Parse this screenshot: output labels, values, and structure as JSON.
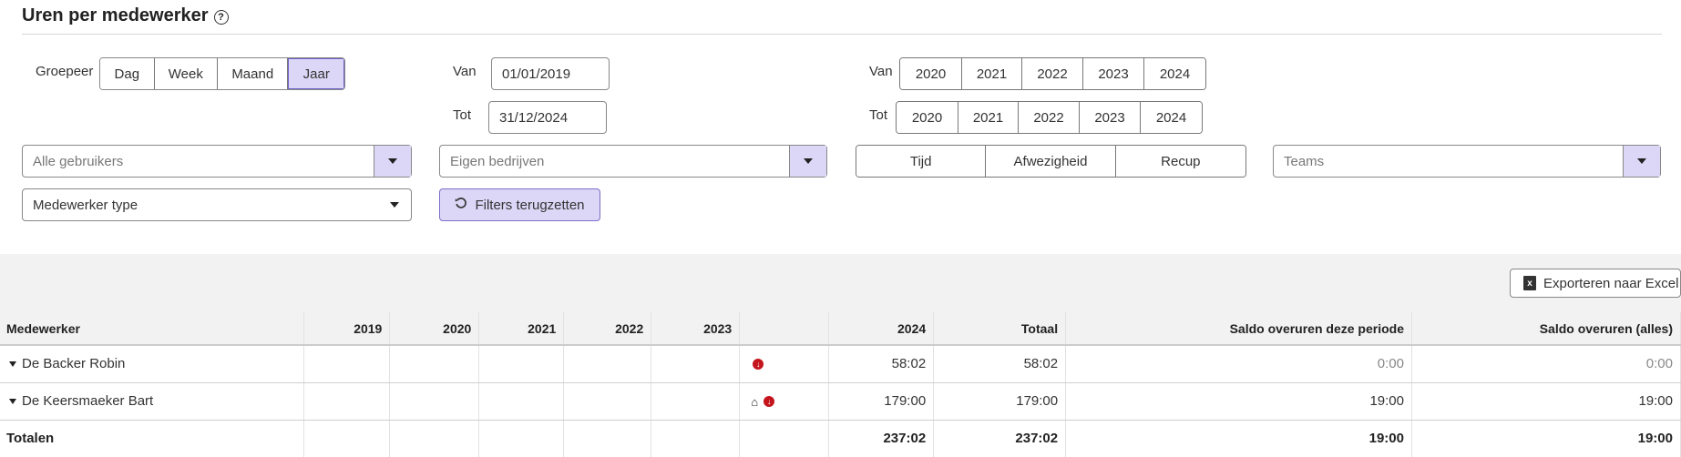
{
  "header": {
    "title": "Uren per medewerker",
    "help_icon": "question-circle-icon"
  },
  "group": {
    "label": "Groepeer",
    "options": [
      "Dag",
      "Week",
      "Maand",
      "Jaar"
    ],
    "active": "Jaar"
  },
  "date_range": {
    "from_label": "Van",
    "from_value": "01/01/2019",
    "to_label": "Tot",
    "to_value": "31/12/2024"
  },
  "year_range": {
    "from_label": "Van",
    "from_years": [
      "2020",
      "2021",
      "2022",
      "2023",
      "2024"
    ],
    "to_label": "Tot",
    "to_years": [
      "2020",
      "2021",
      "2022",
      "2023",
      "2024"
    ]
  },
  "filters": {
    "users_placeholder": "Alle gebruikers",
    "companies_placeholder": "Eigen bedrijven",
    "type_options": [
      "Tijd",
      "Afwezigheid",
      "Recup"
    ],
    "teams_placeholder": "Teams",
    "employee_type_value": "Medewerker type",
    "reset_label": "Filters terugzetten"
  },
  "export": {
    "label": "Exporteren naar Excel",
    "icon": "excel-file-icon"
  },
  "table": {
    "columns": [
      "Medewerker",
      "2019",
      "2020",
      "2021",
      "2022",
      "2023",
      "",
      "2024",
      "Totaal",
      "Saldo overuren deze periode",
      "Saldo overuren (alles)"
    ],
    "rows": [
      {
        "name": "De Backer Robin",
        "cells": [
          "",
          "",
          "",
          "",
          ""
        ],
        "icons": [
          "arrow-down-circle-icon"
        ],
        "y2024": "58:02",
        "total": "58:02",
        "saldo_period": "0:00",
        "saldo_all": "0:00"
      },
      {
        "name": "De Keersmaeker Bart",
        "cells": [
          "",
          "",
          "",
          "",
          ""
        ],
        "icons": [
          "home-icon",
          "arrow-down-circle-icon"
        ],
        "y2024": "179:00",
        "total": "179:00",
        "saldo_period": "19:00",
        "saldo_all": "19:00"
      }
    ],
    "totals": {
      "label": "Totalen",
      "y2024": "237:02",
      "total": "237:02",
      "saldo_period": "19:00",
      "saldo_all": "19:00"
    }
  },
  "colors": {
    "accent_light": "#dcd7f7",
    "accent_border": "#6f63c9",
    "flag_red": "#c4151c"
  }
}
